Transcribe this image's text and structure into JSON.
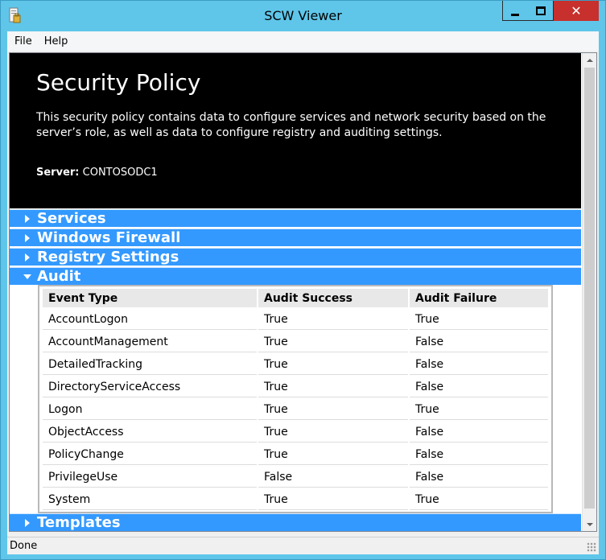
{
  "window": {
    "title": "SCW Viewer",
    "close_glyph": "✕",
    "accent_color": "#5fc6ea",
    "close_color": "#c7302c"
  },
  "menu": {
    "items": [
      "File",
      "Help"
    ]
  },
  "header": {
    "title": "Security Policy",
    "description": "This security policy contains data to configure services and network security based on the server’s role, as well as data to configure registry and auditing settings.",
    "server_label": "Server:",
    "server_name": "CONTOSODC1"
  },
  "sections": [
    {
      "label": "Services",
      "expanded": false
    },
    {
      "label": "Windows Firewall",
      "expanded": false
    },
    {
      "label": "Registry Settings",
      "expanded": false
    },
    {
      "label": "Audit",
      "expanded": true
    },
    {
      "label": "Templates",
      "expanded": false
    }
  ],
  "section_color": "#3399ff",
  "audit_table": {
    "headers": [
      "Event Type",
      "Audit Success",
      "Audit Failure"
    ],
    "rows": [
      [
        "AccountLogon",
        "True",
        "True"
      ],
      [
        "AccountManagement",
        "True",
        "False"
      ],
      [
        "DetailedTracking",
        "True",
        "False"
      ],
      [
        "DirectoryServiceAccess",
        "True",
        "False"
      ],
      [
        "Logon",
        "True",
        "True"
      ],
      [
        "ObjectAccess",
        "True",
        "False"
      ],
      [
        "PolicyChange",
        "True",
        "False"
      ],
      [
        "PrivilegeUse",
        "False",
        "False"
      ],
      [
        "System",
        "True",
        "True"
      ]
    ]
  },
  "status": {
    "text": "Done"
  }
}
